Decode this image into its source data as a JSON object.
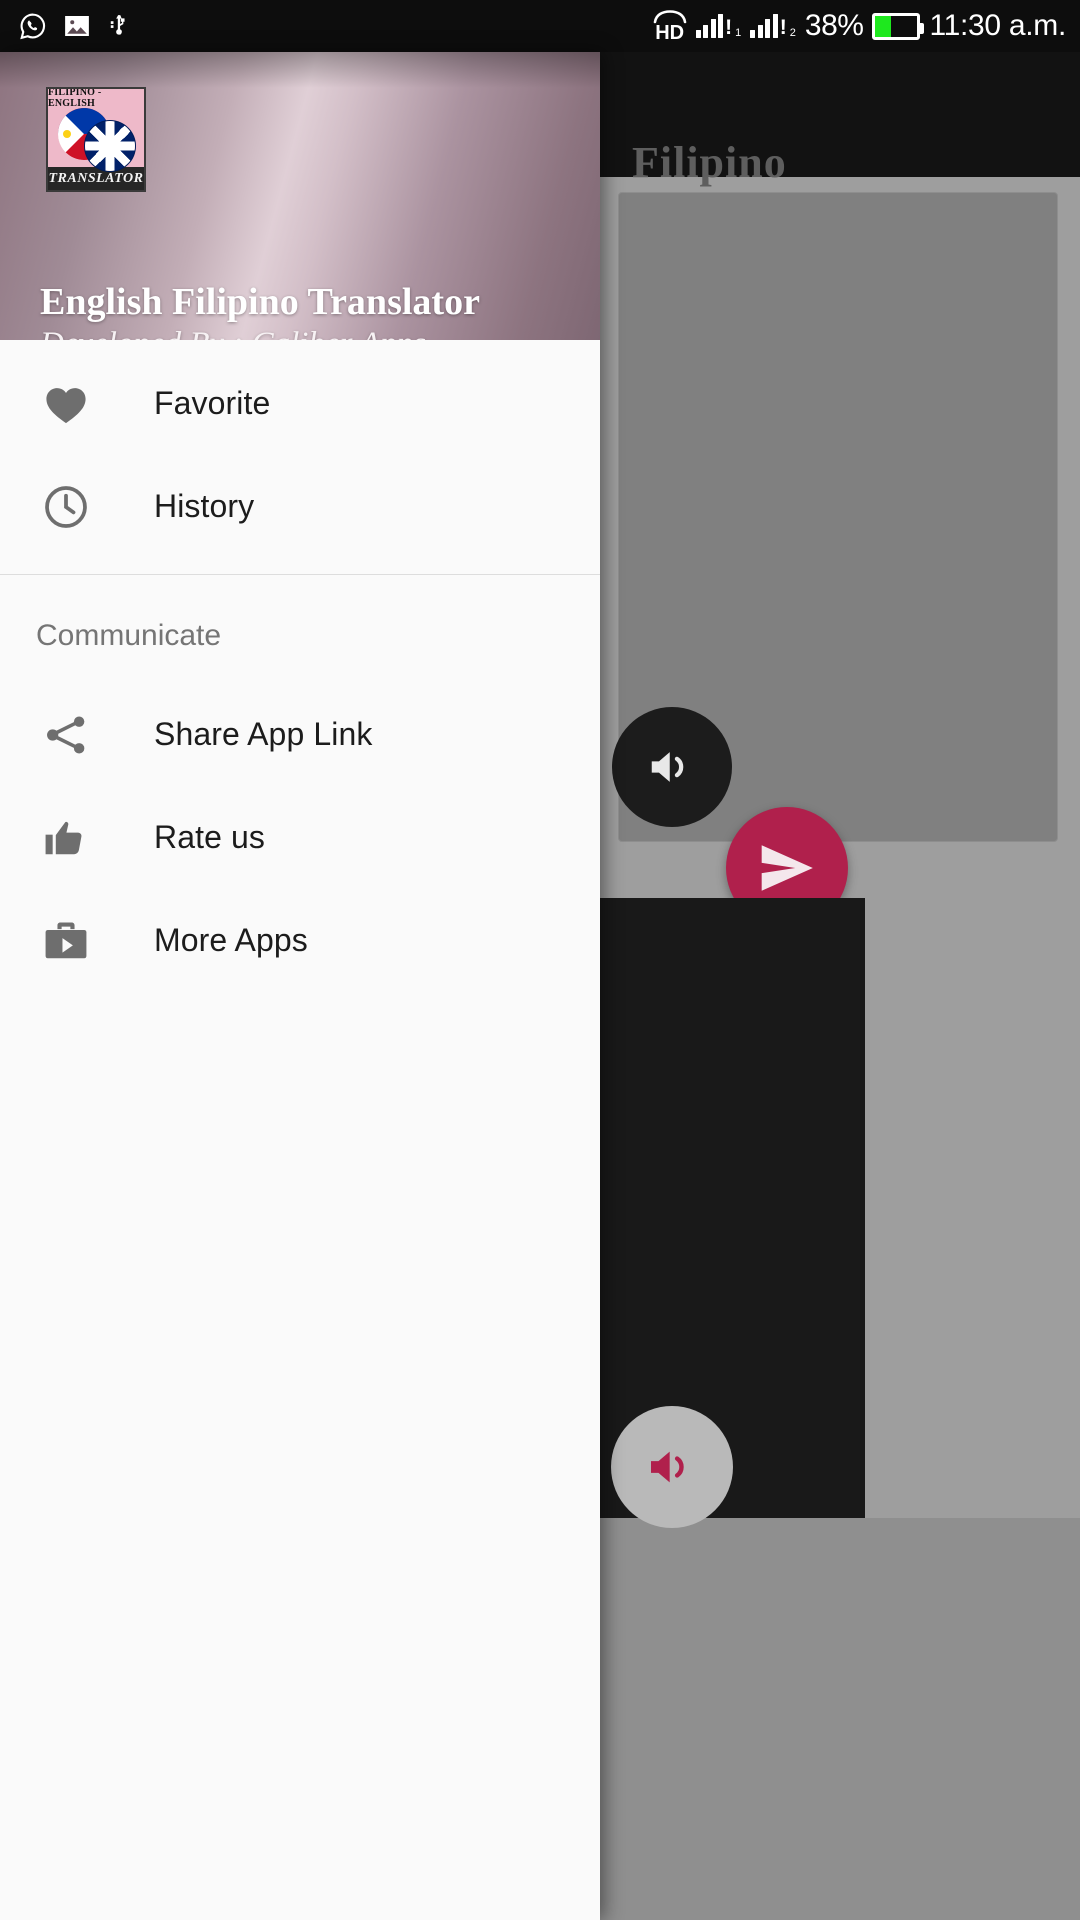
{
  "status_bar": {
    "left_icons": [
      "whatsapp-icon",
      "image-icon",
      "usb-icon"
    ],
    "volte_label": "HD",
    "sim1_alert": "!",
    "sim1_sub": "1",
    "sim2_alert": "!",
    "sim2_sub": "2",
    "battery_percent": "38%",
    "battery_level": 38,
    "battery_color": "#1ee81e",
    "clock": "11:30 a.m."
  },
  "background_app": {
    "appbar_title": "Filipino",
    "speaker_fab_icon": "speaker-icon",
    "send_fab_icon": "send-icon",
    "bottom_speaker_icon": "speaker-icon",
    "accent_color": "#b0204c"
  },
  "drawer": {
    "logo": {
      "top_text": "FILIPINO - ENGLISH",
      "bottom_text": "TRANSLATOR",
      "flags": [
        "philippines-flag-icon",
        "united-kingdom-flag-icon"
      ],
      "background_color": "#eeb9c9"
    },
    "title": "English Filipino Translator",
    "subtitle": "Developed By : Caliber Apps",
    "primary_items": [
      {
        "label": "Favorite",
        "icon": "heart-icon"
      },
      {
        "label": "History",
        "icon": "clock-icon"
      }
    ],
    "section_title": "Communicate",
    "communicate_items": [
      {
        "label": "Share App Link",
        "icon": "share-icon"
      },
      {
        "label": "Rate us",
        "icon": "thumbs-up-icon"
      },
      {
        "label": "More Apps",
        "icon": "briefcase-apps-icon"
      }
    ]
  }
}
